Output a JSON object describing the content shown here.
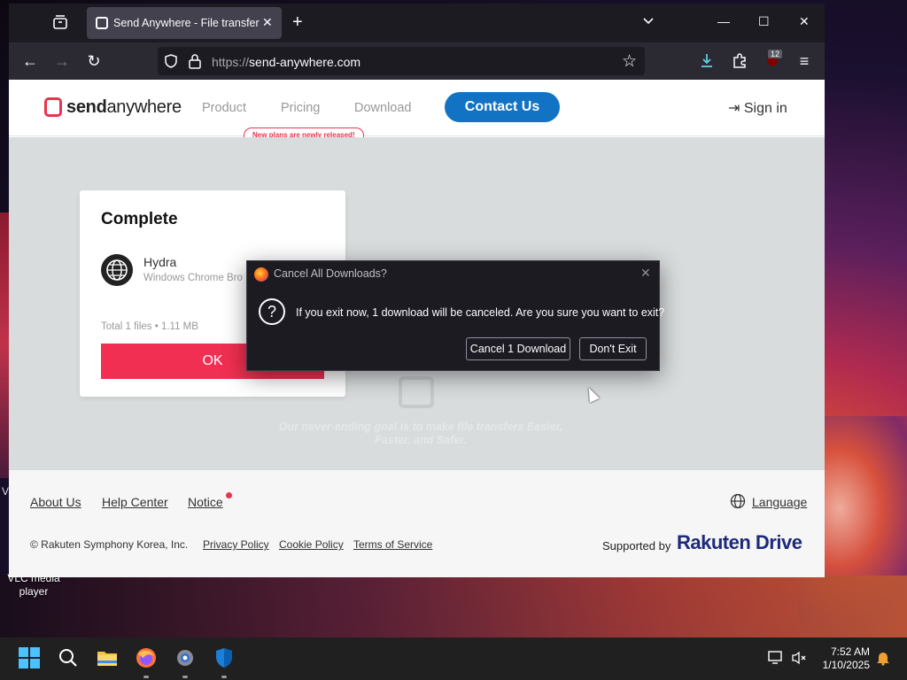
{
  "browser": {
    "tab_title": "Send Anywhere - File transfer",
    "url_scheme": "https://",
    "url_host": "send-anywhere.com",
    "extension_badge": "12"
  },
  "site": {
    "logo_bold": "send",
    "logo_rest": "anywhere",
    "nav": [
      "Product",
      "Pricing",
      "Download"
    ],
    "plans_badge": "New plans are newly released!",
    "contact_label": "Contact Us",
    "signin_label": "Sign in",
    "tagline": "Our never-ending goal is to make file transfers Easier, Faster, and Safer."
  },
  "card": {
    "title": "Complete",
    "item_name": "Hydra",
    "item_sub": "Windows Chrome Bro",
    "total": "Total 1 files • 1.11 MB",
    "ok_label": "OK"
  },
  "footer": {
    "about": "About Us",
    "help": "Help Center",
    "notice": "Notice",
    "language": "Language",
    "copyright": "© Rakuten Symphony Korea, Inc.",
    "privacy": "Privacy Policy",
    "cookie": "Cookie Policy",
    "terms": "Terms of Service",
    "supported_by": "Supported by",
    "rakuten_drive": "Rakuten Drive"
  },
  "dialog": {
    "title": "Cancel All Downloads?",
    "message": "If you exit now, 1 download will be canceled. Are you sure you want to exit?",
    "cancel_label": "Cancel 1 Download",
    "dont_exit_label": "Don't Exit"
  },
  "desktop": {
    "vlc_label": "VLC media player"
  },
  "taskbar": {
    "time": "7:52 AM",
    "date": "1/10/2025"
  },
  "colors": {
    "brand_red": "#f02f52",
    "contact_blue": "#1273c5",
    "dialog_bg": "#1c1b22"
  }
}
